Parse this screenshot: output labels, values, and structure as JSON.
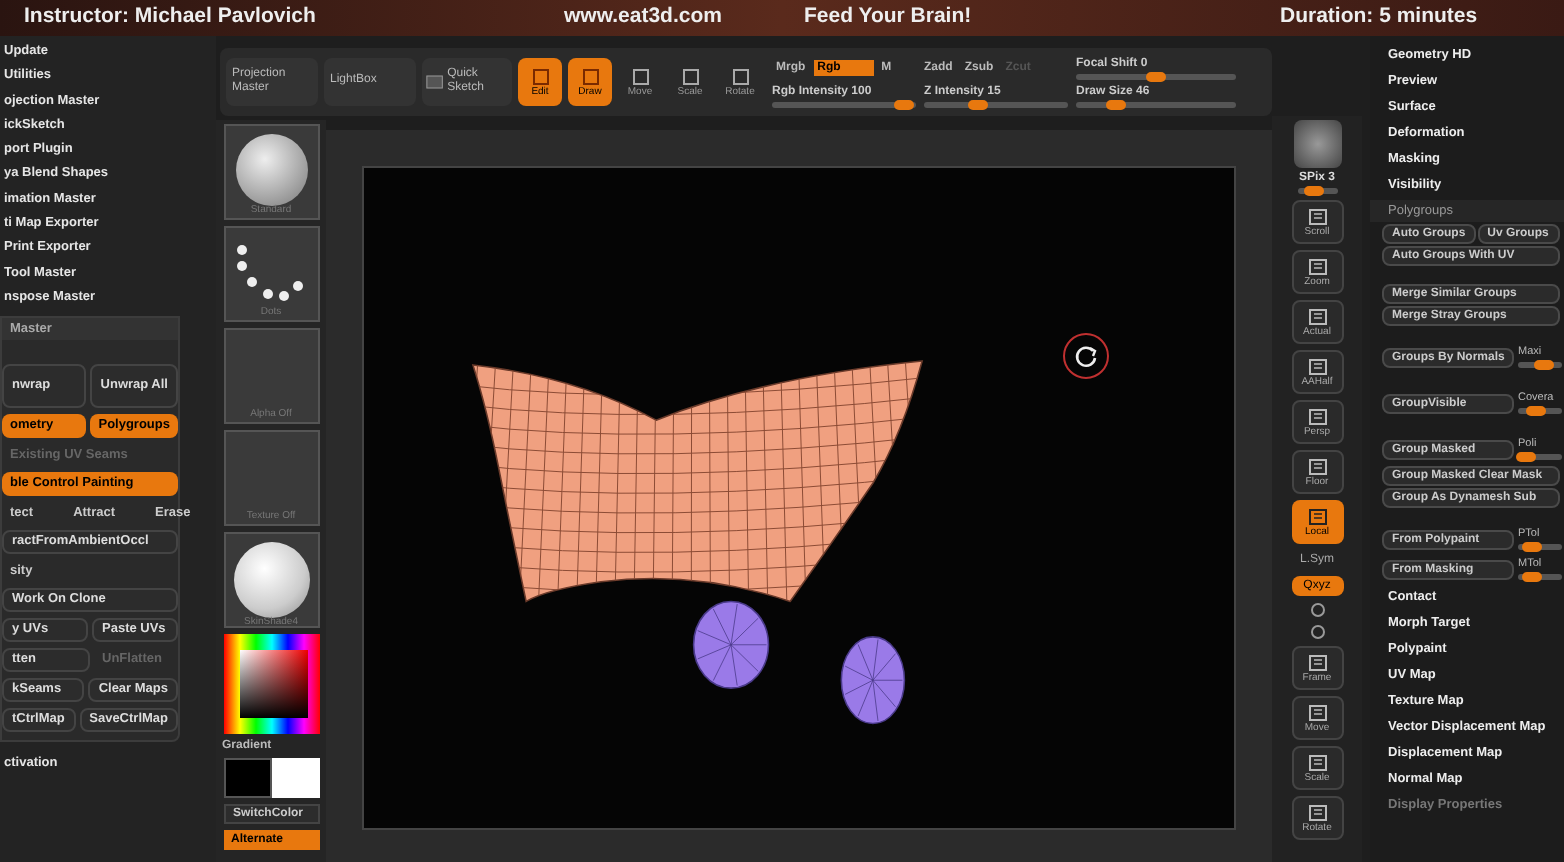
{
  "banner": {
    "instructor": "Instructor: Michael Pavlovich",
    "site": "www.eat3d.com",
    "slogan": "Feed Your Brain!",
    "duration": "Duration: 5 minutes"
  },
  "plugin_menu": [
    "Update",
    "Utilities",
    "ojection Master",
    "ickSketch",
    "port Plugin",
    "ya Blend Shapes",
    "imation Master",
    "ti Map Exporter",
    "Print Exporter",
    "Tool Master",
    "nspose Master"
  ],
  "uv_master": {
    "title": "Master",
    "entries": [
      {
        "kind": "big_pair",
        "buttons": [
          {
            "label": "nwrap",
            "on": false,
            "disabled": false
          },
          {
            "label": "Unwrap All",
            "on": false,
            "disabled": false
          }
        ]
      },
      {
        "kind": "pair",
        "buttons": [
          {
            "label": "ometry",
            "on": true,
            "disabled": false
          },
          {
            "label": "Polygroups",
            "on": true,
            "disabled": false
          }
        ]
      },
      {
        "kind": "note",
        "buttons": [
          {
            "label": "Existing UV Seams",
            "on": false,
            "disabled": true
          }
        ]
      },
      {
        "kind": "wide",
        "buttons": [
          {
            "label": "ble Control Painting",
            "on": true,
            "disabled": false
          }
        ]
      },
      {
        "kind": "labels",
        "buttons": [
          {
            "label": "tect",
            "on": false,
            "disabled": false
          },
          {
            "label": "Attract",
            "on": false,
            "disabled": false
          },
          {
            "label": "Erase",
            "on": false,
            "disabled": false
          }
        ]
      },
      {
        "kind": "wide",
        "buttons": [
          {
            "label": "ractFromAmbientOccl",
            "on": false,
            "disabled": false
          }
        ]
      },
      {
        "kind": "note",
        "buttons": [
          {
            "label": "sity",
            "on": false,
            "disabled": false
          }
        ]
      },
      {
        "kind": "wide",
        "buttons": [
          {
            "label": "Work On Clone",
            "on": false,
            "disabled": false
          }
        ]
      },
      {
        "kind": "pair",
        "buttons": [
          {
            "label": "y UVs",
            "on": false,
            "disabled": false
          },
          {
            "label": "Paste UVs",
            "on": false,
            "disabled": false
          }
        ]
      },
      {
        "kind": "pair",
        "buttons": [
          {
            "label": "tten",
            "on": false,
            "disabled": false
          },
          {
            "label": "UnFlatten",
            "on": false,
            "disabled": true
          }
        ]
      },
      {
        "kind": "pair",
        "buttons": [
          {
            "label": "kSeams",
            "on": false,
            "disabled": false
          },
          {
            "label": "Clear Maps",
            "on": false,
            "disabled": false
          }
        ]
      },
      {
        "kind": "pair",
        "buttons": [
          {
            "label": "tCtrlMap",
            "on": false,
            "disabled": false
          },
          {
            "label": "SaveCtrlMap",
            "on": false,
            "disabled": false
          }
        ]
      }
    ]
  },
  "footer_item": "ctivation",
  "shelf": [
    {
      "kind": "brush",
      "label": "Standard"
    },
    {
      "kind": "dots",
      "label": "Dots"
    },
    {
      "kind": "blank",
      "label": "Alpha Off"
    },
    {
      "kind": "blank",
      "label": "Texture Off"
    },
    {
      "kind": "sphere",
      "label": "SkinShade4"
    }
  ],
  "color": {
    "gradient_label": "Gradient",
    "switch_label": "SwitchColor",
    "alternate": {
      "label": "Alternate",
      "on": true
    }
  },
  "toolbar": {
    "buttons": [
      {
        "kind": "text",
        "label": "Projection Master",
        "on": false
      },
      {
        "kind": "text",
        "label": "LightBox",
        "on": false
      },
      {
        "kind": "sketch",
        "label": "Quick Sketch",
        "on": false
      },
      {
        "kind": "tool",
        "label": "Edit",
        "on": true
      },
      {
        "kind": "tool",
        "label": "Draw",
        "on": true
      },
      {
        "kind": "tool",
        "label": "Move",
        "on": false
      },
      {
        "kind": "tool",
        "label": "Scale",
        "on": false
      },
      {
        "kind": "tool",
        "label": "Rotate",
        "on": false
      }
    ],
    "color_modes": [
      {
        "label": "Mrgb",
        "selected": false
      },
      {
        "label": "Rgb",
        "selected": true
      },
      {
        "label": "M",
        "selected": false
      }
    ],
    "z_modes": [
      {
        "label": "Zadd",
        "disabled": false
      },
      {
        "label": "Zsub",
        "disabled": false
      },
      {
        "label": "Zcut",
        "disabled": true
      }
    ],
    "sliders": [
      {
        "label": "Focal Shift 0",
        "level": 0.5
      },
      {
        "label": "Rgb Intensity 100",
        "level": 0.92
      },
      {
        "label": "Z Intensity 15",
        "level": 0.38
      },
      {
        "label": "Draw Size 46",
        "level": 0.25
      }
    ]
  },
  "right_shelf": [
    {
      "kind": "thumb",
      "label": "SPix 3",
      "active": false,
      "level": 0.4
    },
    {
      "kind": "button",
      "label": "Scroll",
      "active": false
    },
    {
      "kind": "button",
      "label": "Zoom",
      "active": false
    },
    {
      "kind": "button",
      "label": "Actual",
      "active": false
    },
    {
      "kind": "button",
      "label": "AAHalf",
      "active": false
    },
    {
      "kind": "button",
      "label": "Persp",
      "active": false
    },
    {
      "kind": "button",
      "label": "Floor",
      "active": false
    },
    {
      "kind": "button",
      "label": "Local",
      "active": true
    },
    {
      "kind": "small",
      "label": "L.Sym",
      "active": false
    },
    {
      "kind": "small",
      "label": "Qxyz",
      "active": true
    },
    {
      "kind": "glyph",
      "active": false
    },
    {
      "kind": "glyph",
      "active": false
    },
    {
      "kind": "button",
      "label": "Frame",
      "active": false
    },
    {
      "kind": "button",
      "label": "Move",
      "active": false
    },
    {
      "kind": "button",
      "label": "Scale",
      "active": false
    },
    {
      "kind": "button",
      "label": "Rotate",
      "active": false
    }
  ],
  "right_panel": [
    {
      "kind": "menu",
      "label": "Geometry HD"
    },
    {
      "kind": "menu",
      "label": "Preview"
    },
    {
      "kind": "menu",
      "label": "Surface"
    },
    {
      "kind": "menu",
      "label": "Deformation"
    },
    {
      "kind": "menu",
      "label": "Masking"
    },
    {
      "kind": "menu",
      "label": "Visibility"
    },
    {
      "kind": "section",
      "label": "Polygroups"
    },
    {
      "kind": "buttons",
      "labels": [
        "Auto Groups",
        "Uv Groups"
      ]
    },
    {
      "kind": "buttons",
      "labels": [
        "Auto Groups With UV"
      ]
    },
    {
      "kind": "gap"
    },
    {
      "kind": "buttons",
      "labels": [
        "Merge Similar Groups"
      ]
    },
    {
      "kind": "buttons",
      "labels": [
        "Merge Stray Groups"
      ]
    },
    {
      "kind": "gap"
    },
    {
      "kind": "slider",
      "label": "Groups By Normals",
      "side": "Maxi",
      "level": 0.6
    },
    {
      "kind": "gap"
    },
    {
      "kind": "slider",
      "label": "GroupVisible",
      "side": "Covera",
      "level": 0.4
    },
    {
      "kind": "gap"
    },
    {
      "kind": "slider",
      "label": "Group Masked",
      "side": "Poli",
      "level": 0.2
    },
    {
      "kind": "buttons",
      "labels": [
        "Group Masked Clear Mask"
      ]
    },
    {
      "kind": "buttons",
      "labels": [
        "Group As Dynamesh Sub"
      ]
    },
    {
      "kind": "gap"
    },
    {
      "kind": "slider",
      "label": "From Polypaint",
      "side": "PTol",
      "level": 0.3
    },
    {
      "kind": "slider",
      "label": "From Masking",
      "side": "MTol",
      "level": 0.3
    },
    {
      "kind": "menu",
      "label": "Contact"
    },
    {
      "kind": "menu",
      "label": "Morph Target"
    },
    {
      "kind": "menu",
      "label": "Polypaint"
    },
    {
      "kind": "menu",
      "label": "UV Map"
    },
    {
      "kind": "menu",
      "label": "Texture Map"
    },
    {
      "kind": "menu",
      "label": "Vector Displacement Map"
    },
    {
      "kind": "menu",
      "label": "Displacement Map"
    },
    {
      "kind": "menu",
      "label": "Normal Map"
    },
    {
      "kind": "faint",
      "label": "Display Properties"
    }
  ]
}
